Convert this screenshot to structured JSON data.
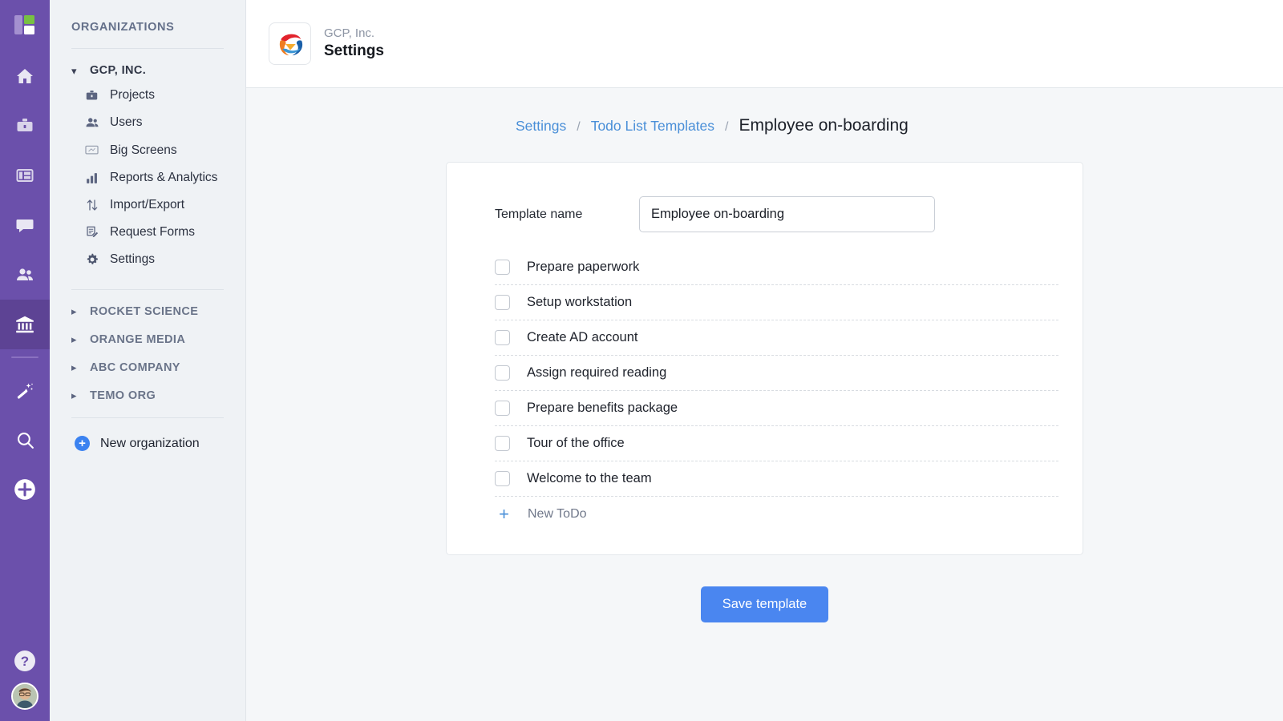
{
  "rail": {
    "logo_name": "app-logo",
    "items": [
      {
        "name": "home-icon",
        "label": "Home"
      },
      {
        "name": "briefcase-icon",
        "label": "Projects"
      },
      {
        "name": "dashboard-icon",
        "label": "Dashboards"
      },
      {
        "name": "chat-icon",
        "label": "Chat"
      },
      {
        "name": "people-icon",
        "label": "People"
      },
      {
        "name": "bank-icon",
        "label": "Organizations",
        "active": true
      },
      {
        "name": "magic-wand-icon",
        "label": "Automation"
      },
      {
        "name": "search-icon",
        "label": "Search"
      },
      {
        "name": "plus-circle-icon",
        "label": "Create"
      }
    ],
    "help_label": "?",
    "avatar_label": "User avatar"
  },
  "sidebar": {
    "title": "ORGANIZATIONS",
    "expanded_org": {
      "name": "GCP, INC.",
      "chevron": "expanded",
      "items": [
        {
          "label": "Projects",
          "icon": "briefcase-icon"
        },
        {
          "label": "Users",
          "icon": "users-icon"
        },
        {
          "label": "Big Screens",
          "icon": "screen-icon"
        },
        {
          "label": "Reports & Analytics",
          "icon": "bar-chart-icon"
        },
        {
          "label": "Import/Export",
          "icon": "arrows-updown-icon"
        },
        {
          "label": "Request Forms",
          "icon": "form-icon"
        },
        {
          "label": "Settings",
          "icon": "gear-icon"
        }
      ]
    },
    "collapsed_orgs": [
      {
        "label": "ROCKET SCIENCE"
      },
      {
        "label": "ORANGE MEDIA"
      },
      {
        "label": "ABC COMPANY"
      },
      {
        "label": "TEMO ORG"
      }
    ],
    "new_organization": "New organization"
  },
  "header": {
    "org_name": "GCP, Inc.",
    "page_title": "Settings",
    "logo_name": "gcp-brand-logo"
  },
  "breadcrumb": {
    "items": [
      {
        "label": "Settings",
        "type": "link"
      },
      {
        "label": "Todo List Templates",
        "type": "link"
      },
      {
        "label": "Employee on-boarding",
        "type": "current"
      }
    ],
    "separator": "/"
  },
  "form": {
    "template_name_label": "Template name",
    "template_name_value": "Employee on-boarding",
    "template_name_placeholder": "Template name",
    "todos": [
      {
        "label": "Prepare paperwork",
        "checked": false
      },
      {
        "label": "Setup workstation",
        "checked": false
      },
      {
        "label": "Create AD account",
        "checked": false
      },
      {
        "label": "Assign required reading",
        "checked": false
      },
      {
        "label": "Prepare benefits package",
        "checked": false
      },
      {
        "label": "Tour of the office",
        "checked": false
      },
      {
        "label": "Welcome to the team",
        "checked": false
      }
    ],
    "new_todo_label": "New ToDo",
    "new_todo_plus": "+",
    "save_label": "Save template"
  },
  "colors": {
    "rail_purple": "#6b50ab",
    "rail_active": "#5d4394",
    "accent_blue": "#4a86f0",
    "link_blue": "#4a8fd8",
    "sidebar_bg": "#eff2f5",
    "page_bg": "#f5f7f9",
    "logo_green": "#78c043"
  }
}
